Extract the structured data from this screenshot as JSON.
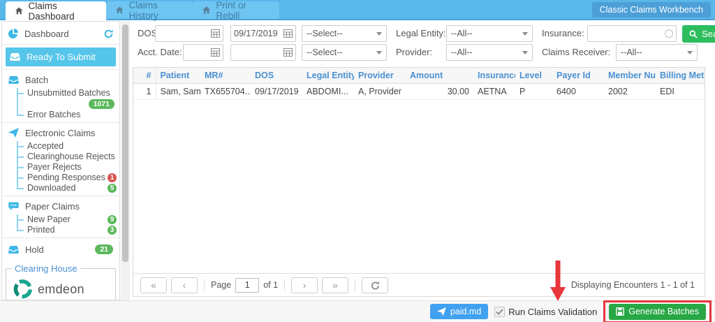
{
  "colors": {
    "tabbar": "#59b7ea",
    "tab-inactive": "#6fc5f1",
    "tab-text": "#3d7ea8",
    "tab-border": "#45a3d6",
    "workbench": "#4c9fd7",
    "active-item": "#55c5e9",
    "icon-blue": "#3cb8e6",
    "link": "#7178d0",
    "header-text": "#4a90d2",
    "green": "#5cb85c",
    "red": "#d9534f",
    "search-green": "#2dbd5f",
    "generate-green": "#28a745",
    "paidmd-blue": "#40a1f1",
    "annotation-red": "#e8353c"
  },
  "tabs": {
    "claims_dashboard": "Claims Dashboard",
    "claims_history": "Claims History",
    "print_or_rebill": "Print or Rebill",
    "workbench": "Classic Claims Workbench"
  },
  "sidebar": {
    "dashboard": "Dashboard",
    "ready_to_submit": "Ready To Submit",
    "batch": "Batch",
    "unsubmitted_batches": "Unsubmitted Batches",
    "unsubmitted_badge": "1071",
    "error_batches": "Error Batches",
    "electronic_claims": "Electronic Claims",
    "accepted": "Accepted",
    "clearinghouse_rejects": "Clearinghouse Rejects",
    "payer_rejects": "Payer Rejects",
    "pending_responses": "Pending Responses",
    "pending_badge": "1",
    "downloaded": "Downloaded",
    "downloaded_badge": "5",
    "paper_claims": "Paper Claims",
    "new_paper": "New Paper",
    "new_paper_badge": "9",
    "printed": "Printed",
    "printed_badge": "3",
    "hold": "Hold",
    "hold_badge": "21",
    "clearing_house_label": "Clearing House",
    "clearing_house_brand": "emdeon"
  },
  "filters": {
    "dos_label": "DOS:",
    "dos_from": "",
    "dos_to": "09/17/2019",
    "dos_select": "--Select--",
    "legal_entity_label": "Legal Entity:",
    "legal_entity_value": "--All--",
    "insurance_label": "Insurance:",
    "insurance_value": "",
    "search_label": "Search",
    "acct_date_label": "Acct. Date:",
    "acct_from": "",
    "acct_to": "",
    "acct_select": "--Select--",
    "provider_label": "Provider:",
    "provider_value": "--All--",
    "claims_receiver_label": "Claims Receiver:",
    "claims_receiver_value": "--All--"
  },
  "grid": {
    "columns": [
      "#",
      "Patient",
      "MR#",
      "DOS",
      "Legal Entity",
      "Provider",
      "Amount",
      "Insurance",
      "Level",
      "Payer Id",
      "Member Nu...",
      "Billing Meth..."
    ],
    "rows": [
      {
        "num": "1",
        "patient": "Sam, Samp",
        "mr": "TX655704...",
        "dos": "09/17/2019",
        "legal_entity": "ABDOMI...",
        "provider": "A, Provider",
        "amount": "30.00",
        "insurance": "AETNA",
        "level": "P",
        "payer_id": "6400",
        "member_number": "2002",
        "billing_method": "EDI"
      }
    ]
  },
  "pagination": {
    "first": "«",
    "prev": "‹",
    "next": "›",
    "last": "»",
    "page_label": "Page",
    "page_value": "1",
    "of_label": "of 1",
    "status": "Displaying Encounters 1 - 1 of 1"
  },
  "footer": {
    "paidmd_label": "paid.md",
    "validation_label": "Run Claims Validation",
    "generate_label": "Generate Batches"
  }
}
